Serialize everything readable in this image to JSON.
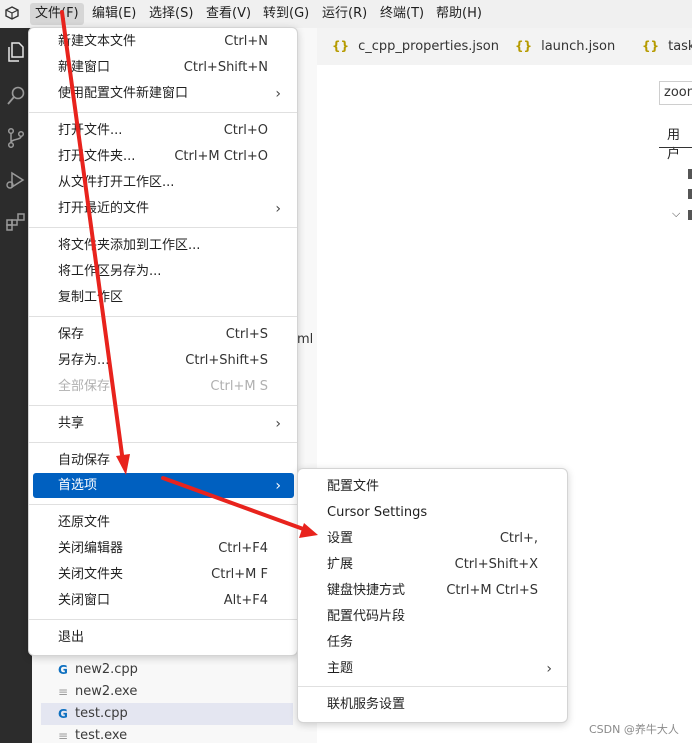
{
  "menubar": {
    "items": [
      "文件(F)",
      "编辑(E)",
      "选择(S)",
      "查看(V)",
      "转到(G)",
      "运行(R)",
      "终端(T)",
      "帮助(H)"
    ]
  },
  "tabs": [
    "c_cpp_properties.json",
    "launch.json",
    "tasks.j"
  ],
  "settings": {
    "search_value": "zoom",
    "user_tab": "用户"
  },
  "explorer": {
    "hidden_fragment": "ml",
    "files": [
      {
        "name": "new2.cpp",
        "icon": "cpp-file-icon",
        "glyph": "G"
      },
      {
        "name": "new2.exe",
        "icon": "file-lines-icon",
        "glyph": "≡"
      },
      {
        "name": "test.cpp",
        "icon": "cpp-file-icon",
        "glyph": "G"
      },
      {
        "name": "test.exe",
        "icon": "file-lines-icon",
        "glyph": "≡"
      }
    ]
  },
  "file_menu": {
    "items": [
      {
        "label": "新建文本文件",
        "key": "Ctrl+N"
      },
      {
        "label": "新建窗口",
        "key": "Ctrl+Shift+N"
      },
      {
        "label": "使用配置文件新建窗口",
        "submenu": "›"
      },
      {
        "label": "打开文件...",
        "key": "Ctrl+O"
      },
      {
        "label": "打开文件夹...",
        "key": "Ctrl+M Ctrl+O"
      },
      {
        "label": "从文件打开工作区..."
      },
      {
        "label": "打开最近的文件",
        "submenu": "›"
      },
      {
        "label": "将文件夹添加到工作区..."
      },
      {
        "label": "将工作区另存为..."
      },
      {
        "label": "复制工作区"
      },
      {
        "label": "保存",
        "key": "Ctrl+S"
      },
      {
        "label": "另存为...",
        "key": "Ctrl+Shift+S"
      },
      {
        "label": "全部保存",
        "key": "Ctrl+M S",
        "disabled": true
      },
      {
        "label": "共享",
        "submenu": "›"
      },
      {
        "label": "自动保存"
      },
      {
        "label": "首选项",
        "submenu": "›",
        "highlighted": true
      },
      {
        "label": "还原文件"
      },
      {
        "label": "关闭编辑器",
        "key": "Ctrl+F4"
      },
      {
        "label": "关闭文件夹",
        "key": "Ctrl+M F"
      },
      {
        "label": "关闭窗口",
        "key": "Alt+F4"
      },
      {
        "label": "退出"
      }
    ]
  },
  "preferences_menu": {
    "items": [
      {
        "label": "配置文件"
      },
      {
        "label": "Cursor Settings"
      },
      {
        "label": "设置",
        "key": "Ctrl+,"
      },
      {
        "label": "扩展",
        "key": "Ctrl+Shift+X"
      },
      {
        "label": "键盘快捷方式",
        "key": "Ctrl+M Ctrl+S"
      },
      {
        "label": "配置代码片段"
      },
      {
        "label": "任务"
      },
      {
        "label": "主题",
        "submenu": "›"
      },
      {
        "label": "联机服务设置"
      }
    ]
  },
  "watermark": "CSDN @养牛大人",
  "colors": {
    "annotation_arrow": "#e8231d",
    "highlight": "#0060c0"
  }
}
